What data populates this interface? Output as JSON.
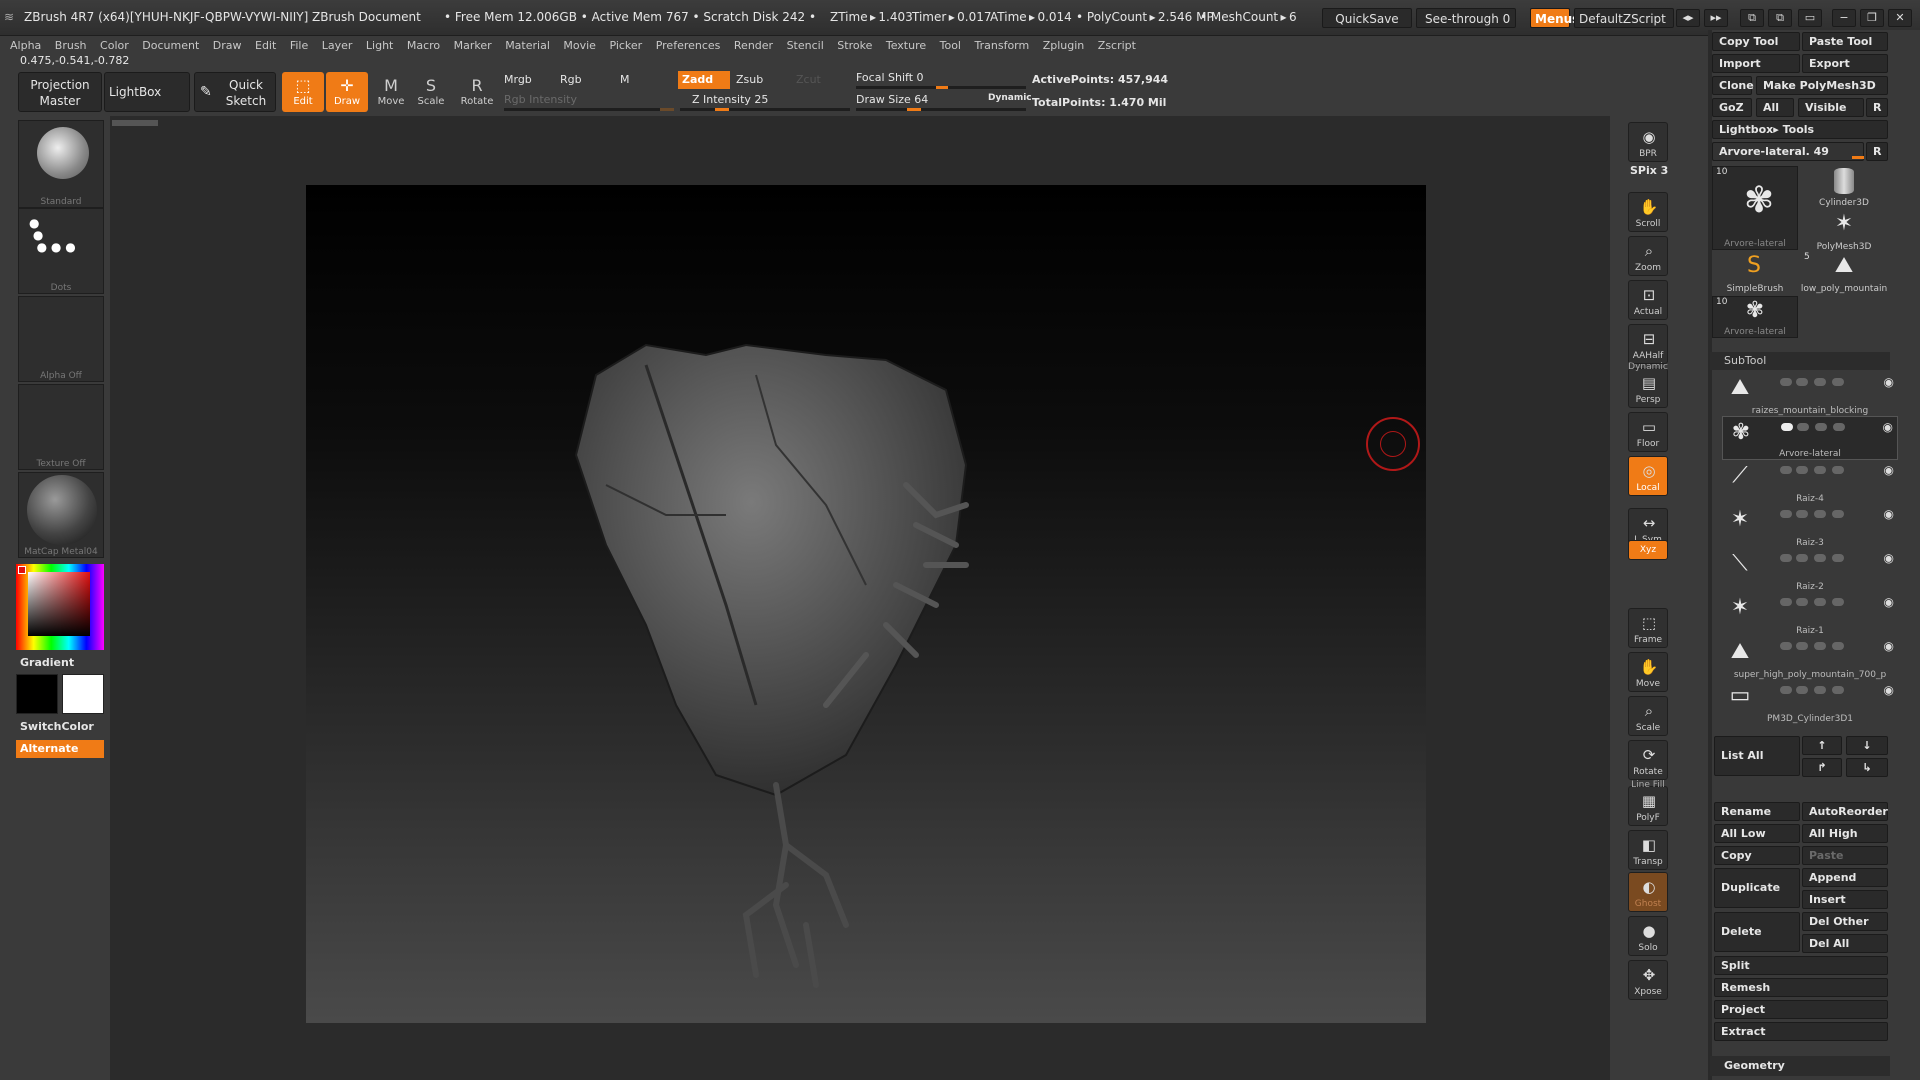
{
  "titlebar": {
    "app": "ZBrush 4R7 (x64)[YHUH-NKJF-QBPW-VYWI-NIIY]",
    "doc": "ZBrush Document",
    "stats": "• Free Mem 12.006GB • Active Mem 767 • Scratch Disk 242 •",
    "ztime": "ZTime ▸ 1.403",
    "timer": "Timer ▸ 0.017",
    "atime": "ATime ▸ 0.014",
    "polycount": "• PolyCount ▸ 2.546 MP",
    "meshcount": "• MeshCount ▸ 6",
    "quicksave": "QuickSave",
    "seethrough": "See-through   0",
    "menus": "Menus",
    "script": "DefaultZScript"
  },
  "menu": [
    "Alpha",
    "Brush",
    "Color",
    "Document",
    "Draw",
    "Edit",
    "File",
    "Layer",
    "Light",
    "Macro",
    "Marker",
    "Material",
    "Movie",
    "Picker",
    "Preferences",
    "Render",
    "Stencil",
    "Stroke",
    "Texture",
    "Tool",
    "Transform",
    "Zplugin",
    "Zscript"
  ],
  "coords": "0.475,-0.541,-0.782",
  "shelf": {
    "projection_master": "Projection Master",
    "lightbox": "LightBox",
    "quick_sketch": "Quick Sketch",
    "edit": "Edit",
    "draw": "Draw",
    "move": "Move",
    "scale": "Scale",
    "rotate": "Rotate",
    "mrgb": "Mrgb",
    "rgb": "Rgb",
    "m": "M",
    "rgb_intensity": "Rgb Intensity",
    "zadd": "Zadd",
    "zsub": "Zsub",
    "zcut": "Zcut",
    "z_intensity": "Z Intensity 25",
    "z_intensity_value": 25,
    "focal_shift": "Focal Shift 0",
    "draw_size": "Draw Size 64",
    "draw_size_value": 64,
    "dynamic": "Dynamic",
    "active_points": "ActivePoints: 457,944",
    "total_points": "TotalPoints: 1.470 Mil"
  },
  "left": {
    "brush": "Standard",
    "stroke": "Dots",
    "alpha": "Alpha Off",
    "texture": "Texture Off",
    "material": "MatCap Metal04",
    "gradient": "Gradient",
    "switchcolor": "SwitchColor",
    "alternate": "Alternate"
  },
  "rightbar": [
    {
      "label": "BPR",
      "icon": "bpr-icon"
    },
    {
      "label": "SPix 3",
      "icon": ""
    },
    {
      "label": "Scroll",
      "icon": "scroll-icon"
    },
    {
      "label": "Zoom",
      "icon": "zoom-icon"
    },
    {
      "label": "Actual",
      "icon": "actual-icon"
    },
    {
      "label": "AAHalf",
      "icon": "aahalf-icon"
    },
    {
      "label": "Persp",
      "icon": "persp-icon"
    },
    {
      "label": "Floor",
      "icon": "floor-icon"
    },
    {
      "label": "Local",
      "icon": "local-icon"
    },
    {
      "label": "L.Sym",
      "icon": "lsym-icon"
    },
    {
      "label": "Xyz",
      "icon": "xyz-icon"
    },
    {
      "label": "Frame",
      "icon": "frame-icon"
    },
    {
      "label": "Move",
      "icon": "move-icon"
    },
    {
      "label": "Scale",
      "icon": "scale-icon"
    },
    {
      "label": "Rotate",
      "icon": "rotate-icon"
    },
    {
      "label": "PolyF",
      "icon": "polyf-icon"
    },
    {
      "label": "Transp",
      "icon": "transp-icon"
    },
    {
      "label": "Ghost",
      "icon": "ghost-icon"
    },
    {
      "label": "Solo",
      "icon": "solo-icon"
    },
    {
      "label": "Xpose",
      "icon": "xpose-icon"
    }
  ],
  "rightbar_extra": {
    "dynamic": "Dynamic",
    "linefill": "Line Fill"
  },
  "tool": {
    "copy_tool": "Copy Tool",
    "paste_tool": "Paste Tool",
    "import": "Import",
    "export": "Export",
    "clone": "Clone",
    "make_polymesh": "Make PolyMesh3D",
    "goz": "GoZ",
    "all": "All",
    "visible": "Visible",
    "r": "R",
    "lightbox_tools": "Lightbox▸ Tools",
    "current_tool": "Arvore-lateral. 49",
    "thumbs": [
      {
        "name": "Arvore-lateral",
        "count": "10"
      },
      {
        "name": "Cylinder3D",
        "count": ""
      },
      {
        "name": "PolyMesh3D",
        "count": ""
      },
      {
        "name": "SimpleBrush",
        "count": ""
      },
      {
        "name": "low_poly_mountain",
        "count": "5"
      },
      {
        "name": "Arvore-lateral",
        "count": "10"
      }
    ]
  },
  "subtool": {
    "title": "SubTool",
    "items": [
      "raizes_mountain_blocking",
      "Arvore-lateral",
      "Raiz-4",
      "Raiz-3",
      "Raiz-2",
      "Raiz-1",
      "super_high_poly_mountain_700_p",
      "PM3D_Cylinder3D1"
    ],
    "list_all": "List  All",
    "rename": "Rename",
    "autoreorder": "AutoReorder",
    "all_low": "All Low",
    "all_high": "All High",
    "copy": "Copy",
    "paste": "Paste",
    "duplicate": "Duplicate",
    "append": "Append",
    "insert": "Insert",
    "delete": "Delete",
    "del_other": "Del Other",
    "del_all": "Del All",
    "split": "Split",
    "remesh": "Remesh",
    "project": "Project",
    "extract": "Extract",
    "geometry": "Geometry"
  }
}
